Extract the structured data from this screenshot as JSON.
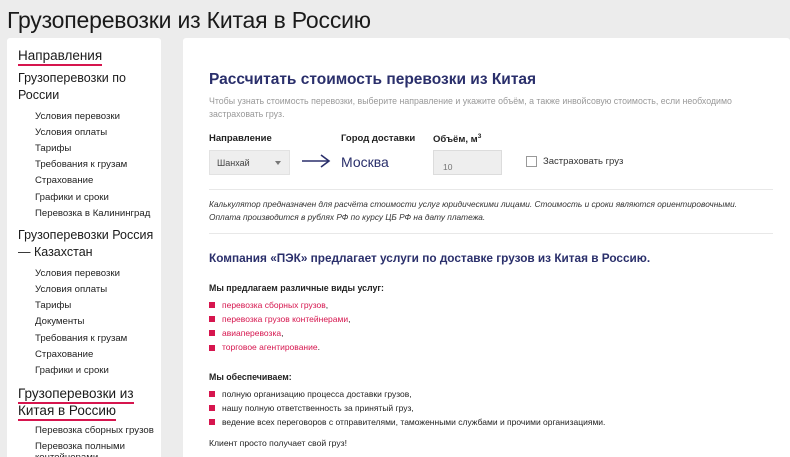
{
  "page": {
    "title": "Грузоперевозки из Китая в Россию"
  },
  "sidebar": {
    "heading": "Направления",
    "sections": [
      {
        "title": "Грузоперевозки по России",
        "items": [
          "Условия перевозки",
          "Условия оплаты",
          "Тарифы",
          "Требования к грузам",
          "Страхование",
          "Графики и сроки",
          "Перевозка в Калининград"
        ]
      },
      {
        "title": "Грузоперевозки Россия — Казахстан",
        "items": [
          "Условия перевозки",
          "Условия оплаты",
          "Тарифы",
          "Документы",
          "Требования к грузам",
          "Страхование",
          "Графики и сроки"
        ]
      },
      {
        "title": "Грузоперевозки из Китая в Россию",
        "items": [
          "Перевозка сборных грузов",
          "Перевозка полными контейнерами"
        ]
      }
    ]
  },
  "calculator": {
    "title": "Рассчитать стоимость перевозки из Китая",
    "description": "Чтобы узнать стоимость перевозки, выберите направление и укажите объём, а также инвойсовую стоимость, если необходимо застраховать груз.",
    "direction_label": "Направление",
    "direction_value": "Шанхай",
    "city_label": "Город доставки",
    "city_value": "Москва",
    "volume_label": "Объём, м",
    "volume_unit_sup": "3",
    "volume_placeholder": "10",
    "insure_label": "Застраховать груз",
    "note": "Калькулятор предназначен для расчёта стоимости услуг юридическими лицами. Стоимость и сроки являются ориентировочными. Оплата производится в рублях РФ по курсу ЦБ РФ на дату платежа."
  },
  "content": {
    "headline": "Компания «ПЭК» предлагает услуги по доставке грузов из Китая в Россию.",
    "services_title": "Мы предлагаем различные виды услуг:",
    "services": [
      "перевозка сборных грузов",
      "перевозка грузов контейнерами",
      "авиаперевозка",
      "торговое агентирование"
    ],
    "services_punct": [
      ",",
      ",",
      ",",
      "."
    ],
    "provide_title": "Мы обеспечиваем:",
    "provide": [
      "полную организацию процесса доставки грузов,",
      "нашу полную ответственность за принятый груз,",
      "ведение всех переговоров с отправителями, таможенными службами и прочими организациями."
    ],
    "final": "Клиент просто получает свой груз!"
  },
  "colors": {
    "accent": "#d6154e",
    "heading_blue": "#2a2f6b",
    "background": "#ececec"
  }
}
